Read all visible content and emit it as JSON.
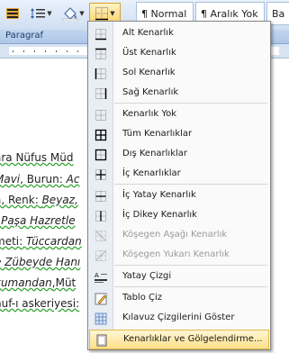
{
  "ribbon": {
    "style_normal": "¶ Normal",
    "style_no_spacing": "¶ Aralık Yok",
    "style_cut": "Ba",
    "group_label": "Paragraf"
  },
  "document": {
    "lines": [
      {
        "segments": [
          {
            "t": "ara Nüfus Müd",
            "s": "plain"
          }
        ]
      },
      {
        "segments": [
          {
            "t": "Mavi",
            "s": "it"
          },
          {
            "t": ", Burun: ",
            "s": "plain"
          },
          {
            "t": "Ac",
            "s": "it"
          }
        ]
      },
      {
        "segments": [
          {
            "t": "a, Renk: ",
            "s": "plain"
          },
          {
            "t": "Beyaz,",
            "s": "it"
          }
        ]
      },
      {
        "segments": [
          {
            "t": "l Paşa Hazretle",
            "s": "it"
          }
        ]
      },
      {
        "segments": [
          {
            "t": "meti: ",
            "s": "plain"
          },
          {
            "t": "Tüccardan",
            "s": "it"
          }
        ]
      },
      {
        "segments": [
          {
            "t": "e Zübeyde Hanı",
            "s": "it"
          }
        ]
      },
      {
        "segments": [
          {
            "t": "kumandan",
            "s": "it"
          },
          {
            "t": ",Müt",
            "s": "plain"
          }
        ]
      },
      {
        "segments": [
          {
            "t": "nuf-ı askeriyesi:",
            "s": "plain"
          }
        ]
      }
    ]
  },
  "menu": {
    "items": [
      {
        "label": "Alt Kenarlık",
        "icon": "border-bottom-icon",
        "enabled": true
      },
      {
        "label": "Üst Kenarlık",
        "icon": "border-top-icon",
        "enabled": true
      },
      {
        "label": "Sol Kenarlık",
        "icon": "border-left-icon",
        "enabled": true
      },
      {
        "label": "Sağ Kenarlık",
        "icon": "border-right-icon",
        "enabled": true
      },
      {
        "label": "Kenarlık Yok",
        "icon": "border-none-icon",
        "enabled": true
      },
      {
        "label": "Tüm Kenarlıklar",
        "icon": "border-all-icon",
        "enabled": true
      },
      {
        "label": "Dış Kenarlıklar",
        "icon": "border-outside-icon",
        "enabled": true
      },
      {
        "label": "İç Kenarlıklar",
        "icon": "border-inside-icon",
        "enabled": true
      },
      {
        "label": "İç Yatay Kenarlık",
        "icon": "border-inside-horizontal-icon",
        "enabled": true
      },
      {
        "label": "İç Dikey Kenarlık",
        "icon": "border-inside-vertical-icon",
        "enabled": true
      },
      {
        "label": "Köşegen Aşağı Kenarlık",
        "icon": "diagonal-down-border-icon",
        "enabled": false
      },
      {
        "label": "Köşegen Yukarı Kenarlık",
        "icon": "diagonal-up-border-icon",
        "enabled": false
      },
      {
        "label": "Yatay Çizgi",
        "icon": "horizontal-line-icon",
        "enabled": true
      },
      {
        "label": "Tablo Çiz",
        "icon": "draw-table-icon",
        "enabled": true
      },
      {
        "label": "Kılavuz Çizgilerini Göster",
        "icon": "view-gridlines-icon",
        "enabled": true
      },
      {
        "label": "Kenarlıklar ve Gölgelendirme...",
        "icon": "borders-shading-icon",
        "enabled": true,
        "highlighted": true
      }
    ]
  }
}
